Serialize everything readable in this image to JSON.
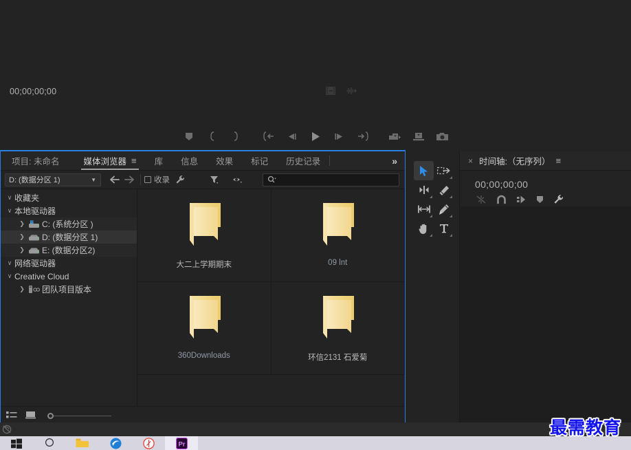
{
  "monitor": {
    "timecode": "00;00;00;00",
    "center_icons": [
      "film-strip-icon",
      "audio-waveform-icon"
    ],
    "transport": [
      {
        "name": "add-marker-button",
        "icon": "marker-icon"
      },
      {
        "name": "mark-in-button",
        "icon": "mark-in-icon"
      },
      {
        "name": "mark-out-button",
        "icon": "mark-out-icon"
      },
      {
        "name": "go-to-in-button",
        "icon": "go-to-in-icon"
      },
      {
        "name": "step-back-button",
        "icon": "step-back-icon"
      },
      {
        "name": "play-stop-button",
        "icon": "play-icon"
      },
      {
        "name": "step-forward-button",
        "icon": "step-forward-icon"
      },
      {
        "name": "go-to-out-button",
        "icon": "go-to-out-icon"
      },
      {
        "name": "insert-button",
        "icon": "insert-icon"
      },
      {
        "name": "overwrite-button",
        "icon": "overwrite-icon"
      },
      {
        "name": "export-frame-button",
        "icon": "camera-icon"
      }
    ]
  },
  "media_browser": {
    "tabs": [
      {
        "label": "项目: 未命名",
        "active": false,
        "burger": false
      },
      {
        "label": "媒体浏览器",
        "active": true,
        "burger": true
      },
      {
        "label": "库",
        "active": false,
        "burger": false
      },
      {
        "label": "信息",
        "active": false,
        "burger": false
      },
      {
        "label": "效果",
        "active": false,
        "burger": false
      },
      {
        "label": "标记",
        "active": false,
        "burger": false
      },
      {
        "label": "历史记录",
        "active": false,
        "burger": false
      }
    ],
    "overflow_label": "»",
    "toolbar": {
      "drive_value": "D: (数据分区 1)",
      "caret": "▼",
      "back_label": "back-arrow",
      "forward_label": "forward-arrow",
      "ingest_label": "收录",
      "wrench_label": "settings-wrench",
      "filter_label": "filter-funnel",
      "view_label": "view-eye",
      "search_placeholder": ""
    },
    "tree": [
      {
        "label": "收藏夹",
        "indent": 0,
        "twisty": "v",
        "icon": "",
        "selected": false
      },
      {
        "label": "本地驱动器",
        "indent": 0,
        "twisty": "v",
        "icon": "",
        "selected": false
      },
      {
        "label": "C: (系统分区 )",
        "indent": 1,
        "twisty": ">",
        "icon": "drive-system-icon",
        "selected": false
      },
      {
        "label": "D: (数据分区 1)",
        "indent": 1,
        "twisty": ">",
        "icon": "drive-icon",
        "selected": true
      },
      {
        "label": "E: (数据分区2)",
        "indent": 1,
        "twisty": ">",
        "icon": "drive-icon",
        "selected": false
      },
      {
        "label": "网络驱动器",
        "indent": 0,
        "twisty": "v",
        "icon": "",
        "selected": false
      },
      {
        "label": "Creative Cloud",
        "indent": 0,
        "twisty": "v",
        "icon": "",
        "selected": false
      },
      {
        "label": "团队项目版本",
        "indent": 1,
        "twisty": ">",
        "icon": "team-project-icon",
        "selected": false
      }
    ],
    "items": [
      {
        "name": "大二上学期期末",
        "icon": "folder-icon",
        "blue_label": false
      },
      {
        "name": "09 lnt",
        "icon": "folder-icon",
        "blue_label": true
      },
      {
        "name": "360Downloads",
        "icon": "folder-icon",
        "blue_label": true
      },
      {
        "name": "环信2131 石爱菊",
        "icon": "folder-icon",
        "blue_label": false
      }
    ],
    "footer": {
      "list_view_label": "list-view-icon",
      "thumb_view_label": "thumbnail-view-icon",
      "zoom_value": "0"
    }
  },
  "tools": [
    {
      "name": "selection-tool",
      "icon": "arrow-cursor-icon",
      "active": true,
      "corner": false
    },
    {
      "name": "track-select-forward-tool",
      "icon": "track-select-icon",
      "active": false,
      "corner": true
    },
    {
      "name": "ripple-edit-tool",
      "icon": "ripple-edit-icon",
      "active": false,
      "corner": true
    },
    {
      "name": "razor-tool",
      "icon": "razor-icon",
      "active": false,
      "corner": true
    },
    {
      "name": "slip-tool",
      "icon": "slip-icon",
      "active": false,
      "corner": true
    },
    {
      "name": "pen-tool",
      "icon": "pen-icon",
      "active": false,
      "corner": true
    },
    {
      "name": "hand-tool",
      "icon": "hand-icon",
      "active": false,
      "corner": true
    },
    {
      "name": "type-tool",
      "icon": "type-icon",
      "active": false,
      "corner": true
    }
  ],
  "timeline": {
    "close_label": "×",
    "title": "时间轴:（无序列）",
    "burger": "≡",
    "timecode": "00;00;00;00",
    "icons": [
      {
        "name": "nest-icon"
      },
      {
        "name": "snap-magnet-icon"
      },
      {
        "name": "linked-selection-icon"
      },
      {
        "name": "marker-icon"
      },
      {
        "name": "timeline-settings-wrench-icon"
      }
    ]
  },
  "status_bar": {
    "icon": "no-sync-icon"
  },
  "taskbar": {
    "items": [
      {
        "name": "start-button",
        "icon": "windows-logo-icon",
        "active": false
      },
      {
        "name": "search-button",
        "icon": "search-circle-icon",
        "active": false
      },
      {
        "name": "file-explorer-button",
        "icon": "folder-taskbar-icon",
        "active": false
      },
      {
        "name": "edge-button",
        "icon": "edge-icon",
        "active": false
      },
      {
        "name": "browser-button",
        "icon": "compass-icon",
        "active": false
      },
      {
        "name": "premiere-pro-button",
        "icon": "premiere-pro-icon",
        "active": true
      }
    ]
  },
  "watermark": {
    "text": "最需教育"
  },
  "colors": {
    "accent": "#2b7fe0",
    "panel_bg": "#232323",
    "folder": "#f4d98a",
    "watermark": "#1414ee"
  }
}
